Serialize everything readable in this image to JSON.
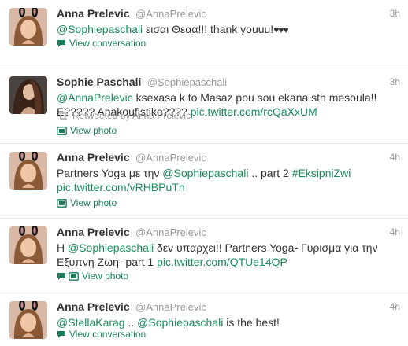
{
  "tweets": [
    {
      "name": "Anna Prelevic",
      "handle": "@AnnaPrelevic",
      "time": "3h",
      "mention": "@Sophiepaschali",
      "text": " εισαι Θεαα!!! thank youuu!",
      "hearts": "♥♥♥",
      "action": "View conversation"
    },
    {
      "name": "Sophie Paschali",
      "handle": "@Sophiepaschali",
      "time": "3h",
      "mention": "@AnnaPrelevic",
      "text_line1": " ksexasa k to Masaz pou sou ekana sth mesoula!!",
      "text_line2": "E????? Anakoufistiko???? ",
      "link": "pic.twitter.com/rcQaXxUM",
      "retweeted_by": "Retweeted by Anna Prelevic",
      "action": "View photo"
    },
    {
      "name": "Anna Prelevic",
      "handle": "@AnnaPrelevic",
      "time": "4h",
      "text_prefix": "Partners Yoga με την ",
      "mention": "@Sophiepaschali",
      "text_mid": " .. part 2 ",
      "hashtag": "#EksipniZwi",
      "link": "pic.twitter.com/vRHBPuTn",
      "action": "View photo"
    },
    {
      "name": "Anna Prelevic",
      "handle": "@AnnaPrelevic",
      "time": "4h",
      "text_prefix": "Η ",
      "mention": "@Sophiepaschali",
      "text_mid": " δεν υπαρχει!! Partners Yoga- Γυρισμα για την",
      "text_line2": "Εξυπνη Ζωη- part 1 ",
      "link": "pic.twitter.com/QTUe14QP",
      "action": "View photo"
    },
    {
      "name": "Anna Prelevic",
      "handle": "@AnnaPrelevic",
      "time": "4h",
      "mention1": "@StellaKarag",
      "text_mid": " .. ",
      "mention2": "@Sophiepaschali",
      "text_end": " is the best!",
      "action": "View conversation"
    }
  ]
}
